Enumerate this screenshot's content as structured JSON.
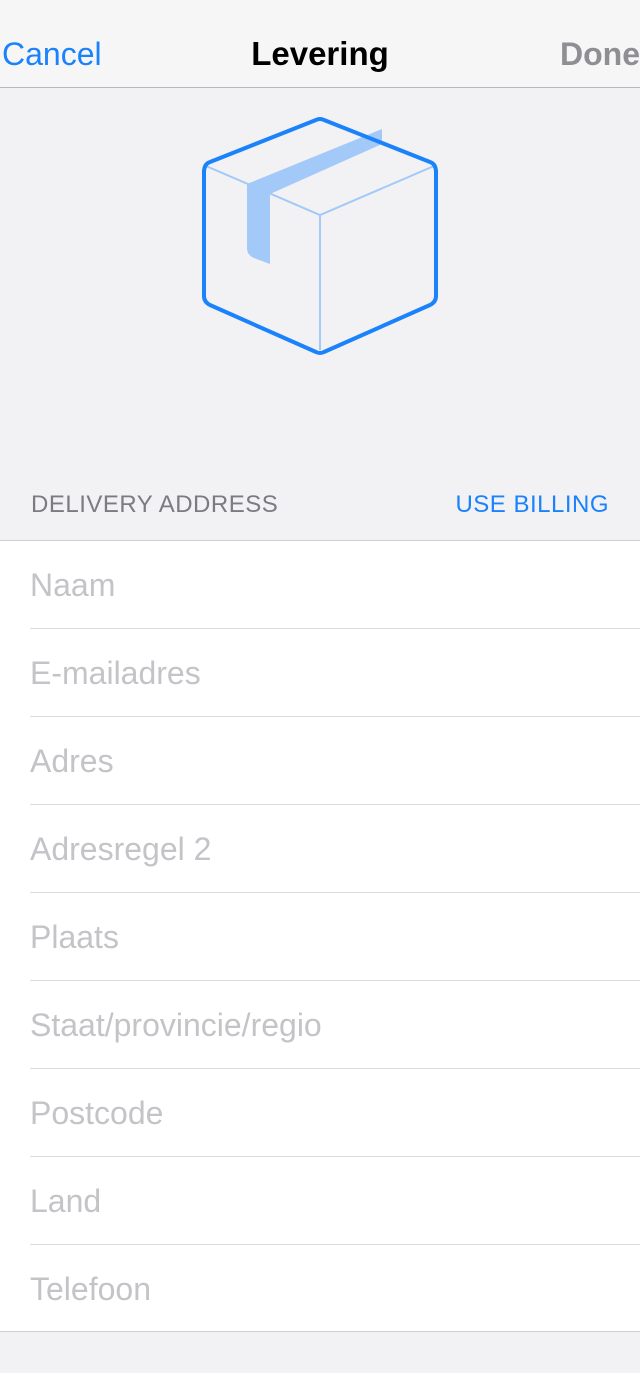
{
  "navbar": {
    "cancel_label": "Cancel",
    "title": "Levering",
    "done_label": "Done"
  },
  "hero": {
    "icon": "package-box-icon"
  },
  "section": {
    "title": "DELIVERY ADDRESS",
    "use_billing_label": "USE BILLING"
  },
  "fields": [
    {
      "placeholder": "Naam",
      "value": ""
    },
    {
      "placeholder": "E-mailadres",
      "value": ""
    },
    {
      "placeholder": "Adres",
      "value": ""
    },
    {
      "placeholder": "Adresregel 2",
      "value": ""
    },
    {
      "placeholder": "Plaats",
      "value": ""
    },
    {
      "placeholder": "Staat/provincie/regio",
      "value": ""
    },
    {
      "placeholder": "Postcode",
      "value": ""
    },
    {
      "placeholder": "Land",
      "value": ""
    },
    {
      "placeholder": "Telefoon",
      "value": ""
    }
  ],
  "colors": {
    "accent": "#1a82fb",
    "disabled": "#8e8e93",
    "placeholder": "#c4c4c8",
    "background": "#f2f2f4",
    "box_tape": "#a2c9f8"
  }
}
